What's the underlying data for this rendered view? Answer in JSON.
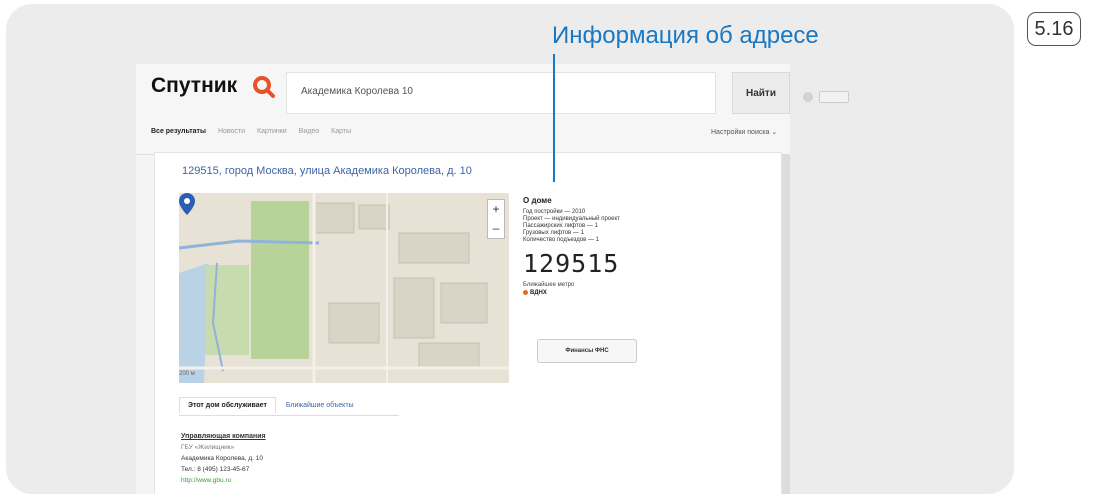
{
  "figure_number": "5.16",
  "callout": "Информация об адресе",
  "app": {
    "logo": "Спутник",
    "search_value": "Академика Королева 10",
    "find_button": "Найти",
    "tabs": [
      "Все результаты",
      "Новости",
      "Картинки",
      "Видео",
      "Карты"
    ],
    "settings_link": "Настройки поиска ⌄"
  },
  "address": {
    "title": "129515, город Москва, улица Академика Королева, д. 10"
  },
  "map": {
    "zoom_in": "+",
    "zoom_out": "–",
    "scale_label": "200 м"
  },
  "about_house": {
    "heading": "О доме",
    "lines": [
      "Год постройки — 2010",
      "Проект — индивидуальный проект",
      "Пассажирских лифтов — 1",
      "Грузовых лифтов — 1",
      "Количество подъездов — 1"
    ],
    "postcode": "129515",
    "nearby_label": "Ближайшее метро",
    "metro_station": "ВДНХ",
    "fns_button": "Финансы ФНС"
  },
  "service": {
    "tab_active": "Этот дом обслуживает",
    "tab_link": "Ближайшие объекты",
    "company_name": "Управляющая компания",
    "company_sub": "ГБУ «Жилищник»",
    "company_addr": "Академика Королева, д. 10",
    "company_phone": "Тел.: 8 (495) 123-45-67",
    "company_site": "http://www.gbu.ru"
  }
}
